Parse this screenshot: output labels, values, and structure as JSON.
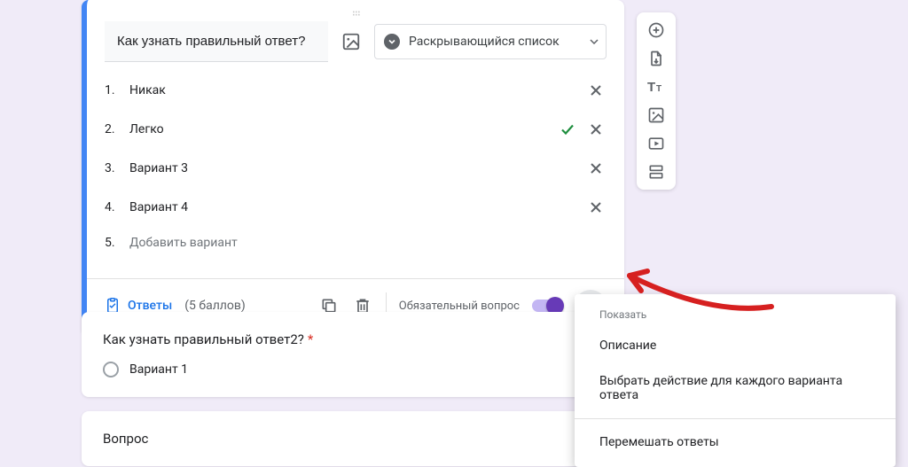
{
  "question": {
    "text": "Как узнать правильный ответ?",
    "type_label": "Раскрывающийся список",
    "options": [
      {
        "num": "1.",
        "label": "Никак",
        "correct": false
      },
      {
        "num": "2.",
        "label": "Легко",
        "correct": true
      },
      {
        "num": "3.",
        "label": "Вариант 3",
        "correct": false
      },
      {
        "num": "4.",
        "label": "Вариант 4",
        "correct": false
      }
    ],
    "add_num": "5.",
    "add_label": "Добавить вариант"
  },
  "footer": {
    "answers_label": "Ответы",
    "points": "(5 баллов)",
    "required_label": "Обязательный вопрос"
  },
  "popup": {
    "title": "Показать",
    "item1": "Описание",
    "item2": "Выбрать действие для каждого варианта ответа",
    "item3": "Перемешать ответы"
  },
  "question2": {
    "title": "Как узнать правильный ответ2?",
    "option1": "Вариант 1"
  },
  "question3": {
    "title": "Вопрос"
  }
}
